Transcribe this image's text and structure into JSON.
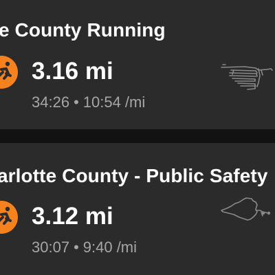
{
  "activities": [
    {
      "title": "e County Running",
      "distance": "3.16 mi",
      "duration": "34:26",
      "separator": "•",
      "pace": "10:54 /mi",
      "icon": "running-activity-icon",
      "map": "route-map-thumbnail"
    },
    {
      "title": "arlotte County - Public Safety",
      "distance": "3.12 mi",
      "duration": "30:07",
      "separator": "•",
      "pace": "9:40 /mi",
      "icon": "running-activity-icon",
      "map": "route-map-thumbnail"
    }
  ],
  "colors": {
    "background": "#121212",
    "card": "#2b2b2b",
    "accent": "#f5821f",
    "text_primary": "#ffffff",
    "text_secondary": "#a6a6a6",
    "route_line": "#8a8a8a"
  }
}
